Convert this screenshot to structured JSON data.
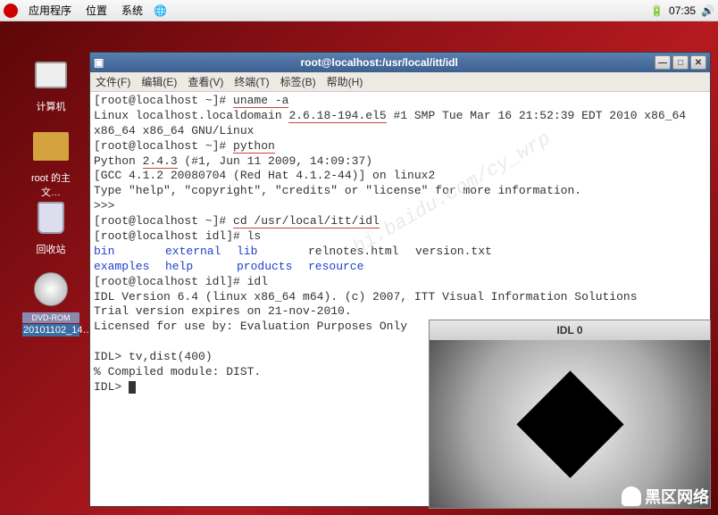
{
  "taskbar": {
    "app": "应用程序",
    "places": "位置",
    "system": "系统",
    "clock": "07:35"
  },
  "desktop": {
    "computer": "计算机",
    "home": "root 的主文…",
    "trash": "回收站",
    "cdrom_top": "DVD-ROM",
    "cdrom": "20101102_14…"
  },
  "term": {
    "title": "root@localhost:/usr/local/itt/idl",
    "menu": {
      "file": "文件(F)",
      "edit": "编辑(E)",
      "view": "查看(V)",
      "terminal": "终端(T)",
      "tabs": "标签(B)",
      "help": "帮助(H)"
    },
    "lines": {
      "l1a": "[root@localhost ~]# ",
      "l1b": "uname -a",
      "l2a": "Linux localhost.localdomain ",
      "l2b": "2.6.18-194.el5",
      "l2c": " #1 SMP Tue Mar 16 21:52:39 EDT 2010 x86_64 x86_64 x86_64 GNU/Linux",
      "l3a": "[root@localhost ~]# ",
      "l3b": "python",
      "l4a": "Python ",
      "l4b": "2.4.3",
      "l4c": " (#1, Jun 11 2009, 14:09:37)",
      "l5": "[GCC 4.1.2 20080704 (Red Hat 4.1.2-44)] on linux2",
      "l6": "Type \"help\", \"copyright\", \"credits\" or \"license\" for more information.",
      "l7": ">>>",
      "l8a": "[root@localhost ~]# ",
      "l8b": "cd /usr/local/itt/idl",
      "l9": "[root@localhost idl]# ls",
      "l10a": "bin",
      "l10b": "external",
      "l10c": "lib",
      "l10d": "relnotes.html",
      "l10e": "version.txt",
      "l11a": "examples",
      "l11b": "help",
      "l11c": "products",
      "l11d": "resource",
      "l12": "[root@localhost idl]# idl",
      "l13": "IDL Version 6.4 (linux x86_64 m64). (c) 2007, ITT Visual Information Solutions",
      "l14": "Trial version expires on 21-nov-2010.",
      "l15": "Licensed for use by: Evaluation Purposes Only",
      "l16": "IDL> tv,dist(400)",
      "l17": "% Compiled module: DIST.",
      "l18": "IDL> "
    },
    "watermark": "hi.baidu.com/cy_wrp"
  },
  "idl": {
    "title": "IDL 0"
  },
  "logo": "黑区网络"
}
